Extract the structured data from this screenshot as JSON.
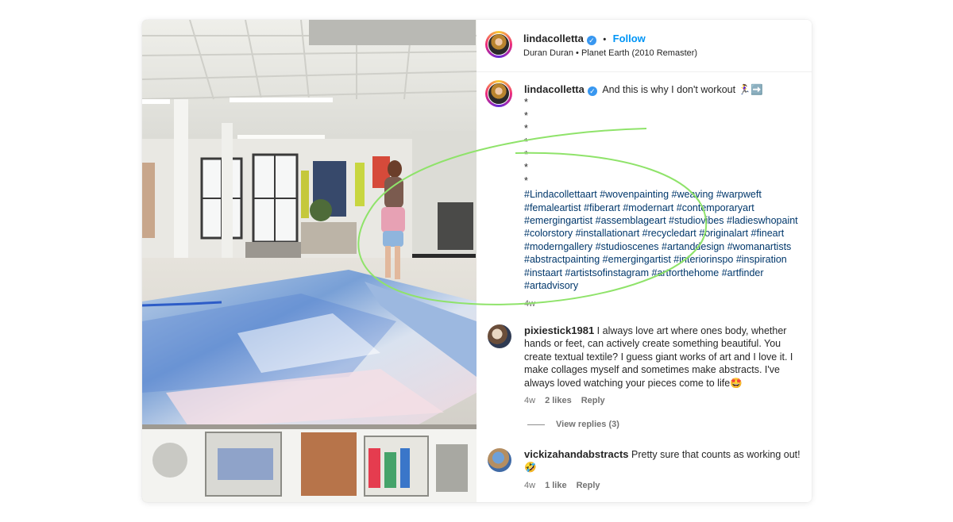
{
  "header": {
    "username": "lindacolletta",
    "separator": "•",
    "follow_label": "Follow",
    "audio": "Duran Duran • Planet Earth (2010 Remaster)"
  },
  "caption": {
    "username": "lindacolletta",
    "text": "And this is why I don't workout 🏃‍♀️➡️",
    "dots": [
      "*",
      "*",
      "*",
      "*",
      "*",
      "*",
      "*"
    ],
    "hashtags": "#Lindacollettaart #wovenpainting #weaving #warpweft #femaleartist #fiberart #modernart #contemporaryart #emergingartist #assemblageart #studiovibes #ladieswhopaint #colorstory #installationart #recycledart #originalart #fineart #moderngallery #studioscenes #artanddesign #womanartists #abstractpainting #emergingartist #interiorinspo #inspiration #instaart #artistsofinstagram #artforthehome #artfinder #artadvisory",
    "time": "4w"
  },
  "comments": [
    {
      "username": "pixiestick1981",
      "text": "I always love art where ones body, whether hands or feet, can actively create something beautiful. You create textual textile? I guess giant works of art and I love it. I make collages myself and sometimes make abstracts. I've always loved watching your pieces come to life🤩",
      "time": "4w",
      "likes": "2 likes",
      "reply": "Reply",
      "view_replies": "View replies (3)"
    },
    {
      "username": "vickizahandabstracts",
      "text": "Pretty sure that counts as working out! 🤣",
      "time": "4w",
      "likes": "1 like",
      "reply": "Reply"
    }
  ],
  "icons": {
    "verified": "verified-badge-icon"
  },
  "colors": {
    "link": "#0095f6",
    "hashtag": "#00376b",
    "annotation": "#8fe36a"
  }
}
